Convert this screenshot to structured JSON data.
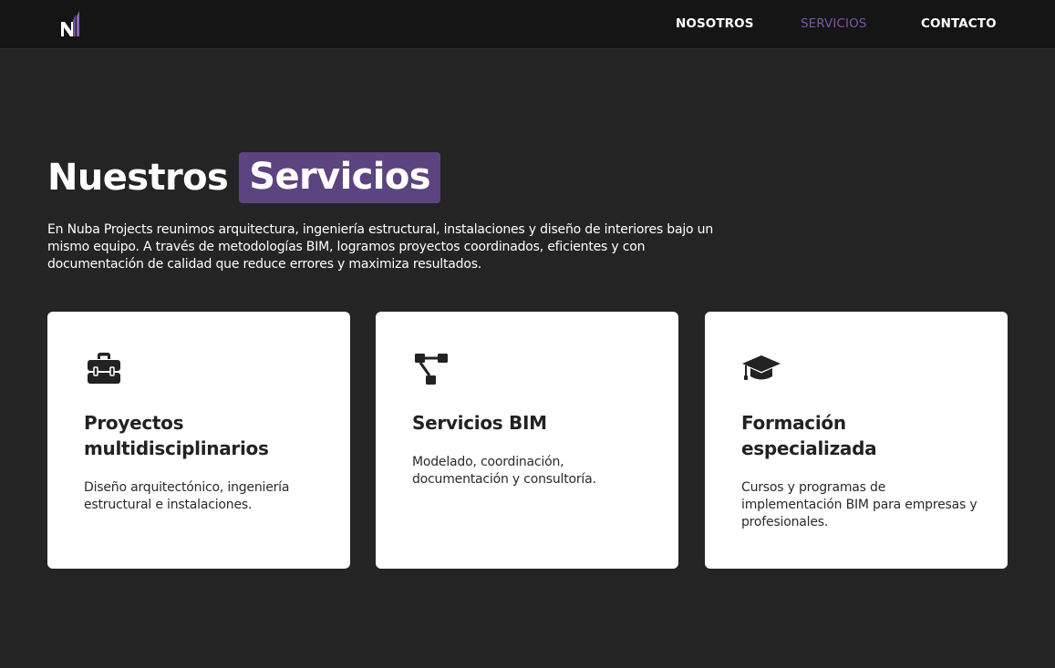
{
  "nav": {
    "logo_icon": "nuba-n-logo-icon",
    "items": [
      {
        "label": "NOSOTROS",
        "active": false
      },
      {
        "label": "SERVICIOS",
        "active": true
      },
      {
        "label": "CONTACTO",
        "active": false
      }
    ],
    "active_color": "#7a56a6"
  },
  "hero": {
    "title_plain": "Nuestros",
    "title_highlight": "Servicios",
    "highlight_color": "#5b4480",
    "intro": "En Nuba Projects reunimos arquitectura, ingeniería estructural, instalaciones y diseño de interiores bajo un mismo equipo. A través de metodologías BIM, logramos proyectos coordinados, eficientes y con documentación de calidad que reduce errores y maximiza resultados."
  },
  "cards": [
    {
      "icon": "toolbox-icon",
      "title": "Proyectos multidisciplinarios",
      "text": "Diseño arquitectónico, ingeniería estructural e instalaciones."
    },
    {
      "icon": "diagram-flow-icon",
      "title": "Servicios BIM",
      "text": "Modelado, coordinación, documentación y consultoría."
    },
    {
      "icon": "graduation-cap-icon",
      "title": "Formación especializada",
      "text": "Cursos y programas de implementación BIM para empresas y profesionales."
    }
  ],
  "colors": {
    "background": "#242424",
    "navbar": "#151515",
    "card": "#ffffff"
  }
}
